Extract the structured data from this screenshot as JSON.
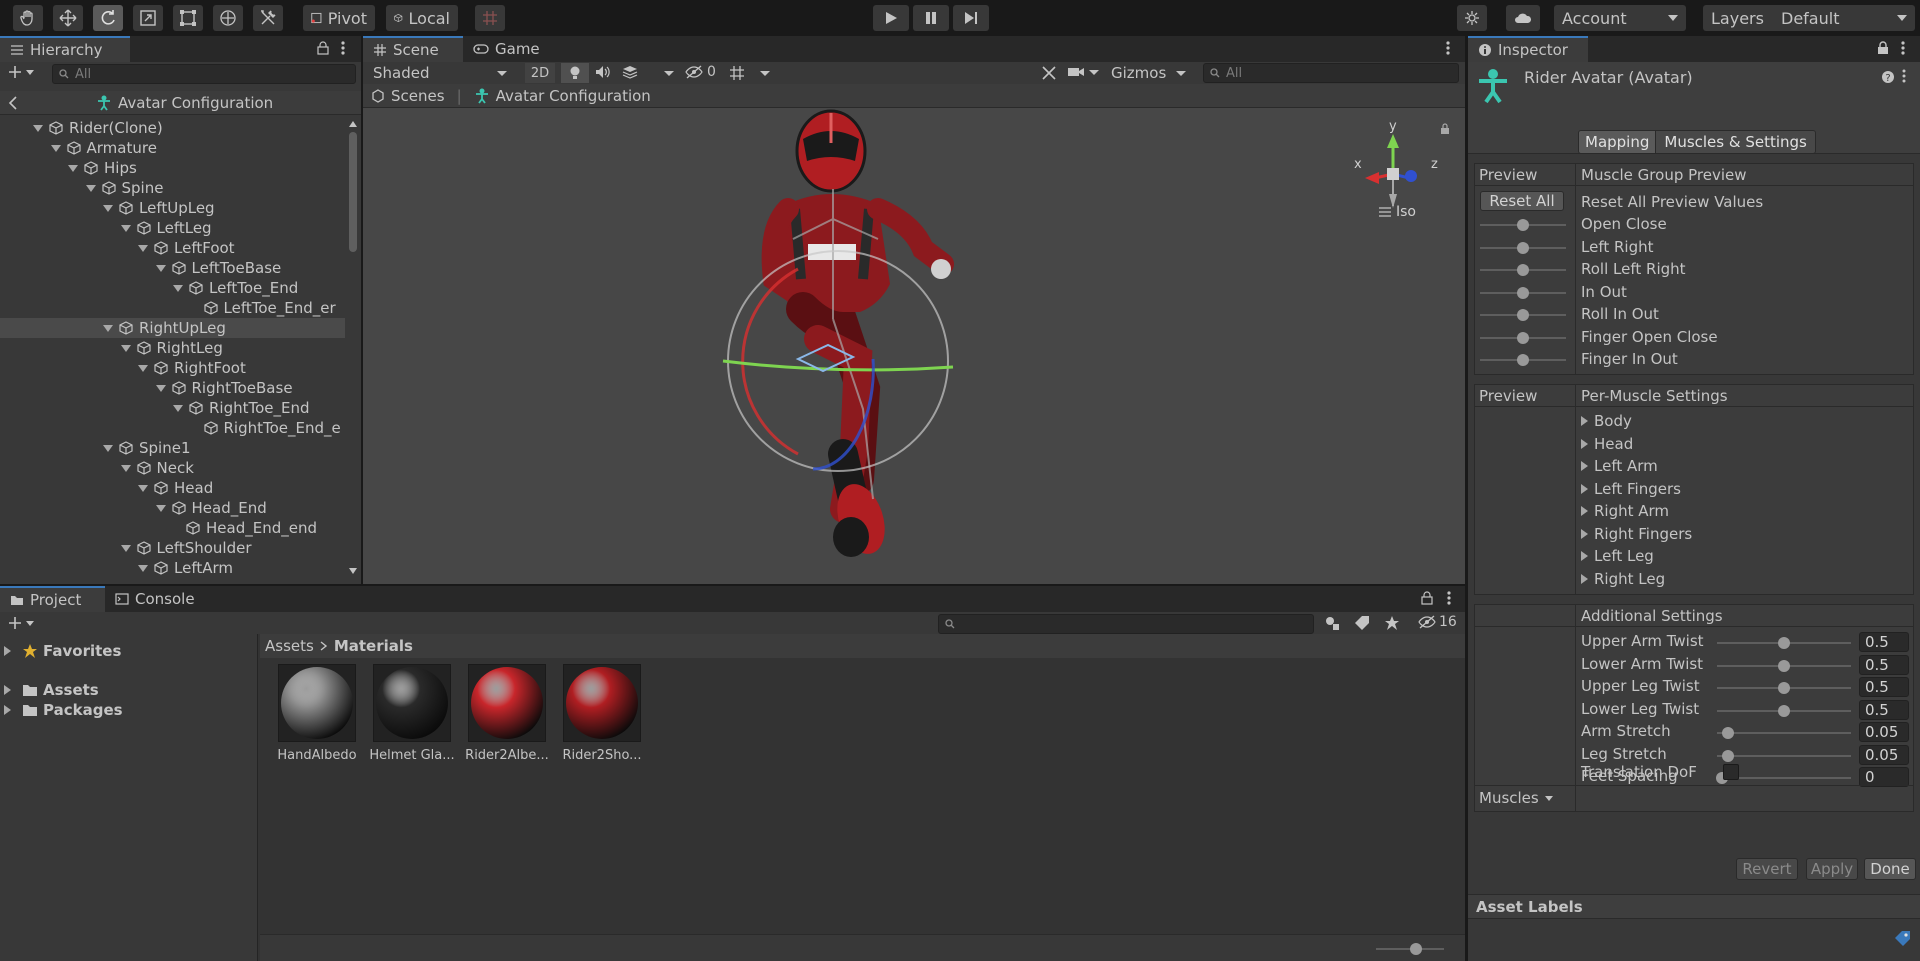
{
  "toolbar": {
    "pivot": "Pivot",
    "local": "Local",
    "account": "Account",
    "layers": "Layers",
    "layout": "Default"
  },
  "hierarchy": {
    "tab": "Hierarchy",
    "search_placeholder": "All",
    "context": "Avatar Configuration",
    "items": [
      {
        "label": "Rider(Clone)",
        "depth": 0,
        "expanded": true
      },
      {
        "label": "Armature",
        "depth": 1,
        "expanded": true
      },
      {
        "label": "Hips",
        "depth": 2,
        "expanded": true
      },
      {
        "label": "Spine",
        "depth": 3,
        "expanded": true
      },
      {
        "label": "LeftUpLeg",
        "depth": 4,
        "expanded": true
      },
      {
        "label": "LeftLeg",
        "depth": 5,
        "expanded": true
      },
      {
        "label": "LeftFoot",
        "depth": 6,
        "expanded": true
      },
      {
        "label": "LeftToeBase",
        "depth": 7,
        "expanded": true
      },
      {
        "label": "LeftToe_End",
        "depth": 8,
        "expanded": true
      },
      {
        "label": "LeftToe_End_er",
        "depth": 9,
        "expanded": false,
        "leaf": true
      },
      {
        "label": "RightUpLeg",
        "depth": 4,
        "expanded": true,
        "selected": true
      },
      {
        "label": "RightLeg",
        "depth": 5,
        "expanded": true
      },
      {
        "label": "RightFoot",
        "depth": 6,
        "expanded": true
      },
      {
        "label": "RightToeBase",
        "depth": 7,
        "expanded": true
      },
      {
        "label": "RightToe_End",
        "depth": 8,
        "expanded": true
      },
      {
        "label": "RightToe_End_e",
        "depth": 9,
        "expanded": false,
        "leaf": true
      },
      {
        "label": "Spine1",
        "depth": 4,
        "expanded": true
      },
      {
        "label": "Neck",
        "depth": 5,
        "expanded": true
      },
      {
        "label": "Head",
        "depth": 6,
        "expanded": true
      },
      {
        "label": "Head_End",
        "depth": 7,
        "expanded": true
      },
      {
        "label": "Head_End_end",
        "depth": 8,
        "expanded": false,
        "leaf": true
      },
      {
        "label": "LeftShoulder",
        "depth": 5,
        "expanded": true
      },
      {
        "label": "LeftArm",
        "depth": 6,
        "expanded": true
      }
    ]
  },
  "scene": {
    "tab_scene": "Scene",
    "tab_game": "Game",
    "shading": "Shaded",
    "mode_2d": "2D",
    "hidden_count": "0",
    "gizmos": "Gizmos",
    "search_placeholder": "All",
    "breadcrumb_scenes": "Scenes",
    "breadcrumb_current": "Avatar Configuration",
    "axis_y": "y",
    "axis_x": "x",
    "axis_z": "z",
    "projection": "Iso"
  },
  "project": {
    "tab_project": "Project",
    "tab_console": "Console",
    "hidden_count": "16",
    "favorites": "Favorites",
    "assets": "Assets",
    "packages": "Packages",
    "path_root": "Assets",
    "path_current": "Materials",
    "materials": [
      {
        "label": "HandAlbedo",
        "color": "#8a8a8a"
      },
      {
        "label": "Helmet Gla...",
        "color": "#2a2a2a"
      },
      {
        "label": "Rider2Albe...",
        "color": "#c8262b"
      },
      {
        "label": "Rider2Sho...",
        "color": "#b01e22"
      }
    ]
  },
  "inspector": {
    "tab": "Inspector",
    "title": "Rider Avatar (Avatar)",
    "tab_mapping": "Mapping",
    "tab_muscles": "Muscles & Settings",
    "preview": "Preview",
    "muscle_group_preview": "Muscle Group Preview",
    "reset_all": "Reset All",
    "reset_all_label": "Reset All Preview Values",
    "group_sliders": [
      {
        "label": "Open Close",
        "value": 0.5
      },
      {
        "label": "Left Right",
        "value": 0.5
      },
      {
        "label": "Roll Left Right",
        "value": 0.5
      },
      {
        "label": "In Out",
        "value": 0.5
      },
      {
        "label": "Roll In Out",
        "value": 0.5
      },
      {
        "label": "Finger Open Close",
        "value": 0.5
      },
      {
        "label": "Finger In Out",
        "value": 0.5
      }
    ],
    "per_muscle": "Per-Muscle Settings",
    "muscle_groups": [
      "Body",
      "Head",
      "Left Arm",
      "Left Fingers",
      "Right Arm",
      "Right Fingers",
      "Left Leg",
      "Right Leg"
    ],
    "additional": "Additional Settings",
    "settings": [
      {
        "label": "Upper Arm Twist",
        "value": "0.5",
        "fraction": 0.5
      },
      {
        "label": "Lower Arm Twist",
        "value": "0.5",
        "fraction": 0.5
      },
      {
        "label": "Upper Leg Twist",
        "value": "0.5",
        "fraction": 0.5
      },
      {
        "label": "Lower Leg Twist",
        "value": "0.5",
        "fraction": 0.5
      },
      {
        "label": "Arm Stretch",
        "value": "0.05",
        "fraction": 0.05
      },
      {
        "label": "Leg Stretch",
        "value": "0.05",
        "fraction": 0.05
      },
      {
        "label": "Feet Spacing",
        "value": "0",
        "fraction": 0.0
      }
    ],
    "translation_dof": "Translation DoF",
    "muscles_dropdown": "Muscles",
    "revert": "Revert",
    "apply": "Apply",
    "done": "Done",
    "asset_labels": "Asset Labels"
  }
}
